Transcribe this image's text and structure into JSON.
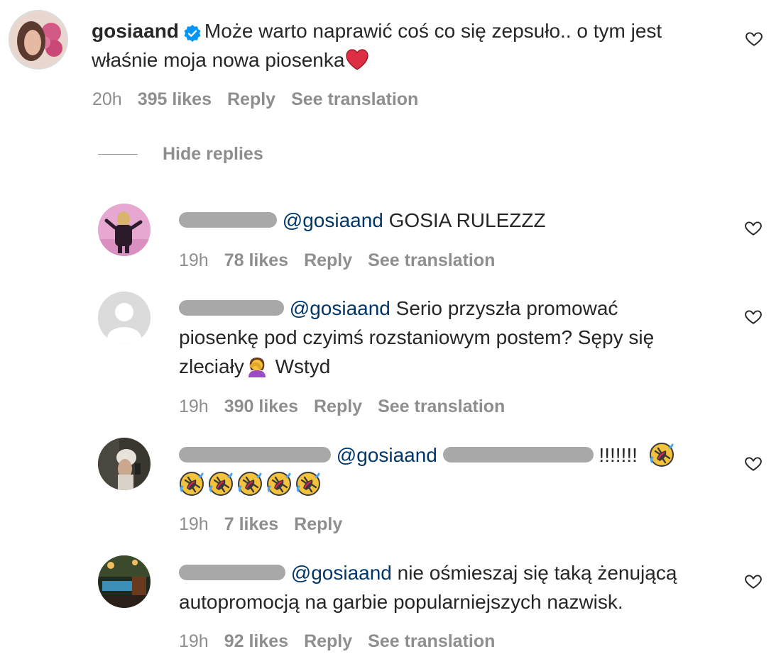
{
  "main_comment": {
    "username": "gosiaand",
    "text": "Może warto naprawić coś co się zepsuło.. o tym jest właśnie moja nowa piosenka",
    "emoji": "red-heart",
    "time": "20h",
    "likes": "395 likes",
    "reply": "Reply",
    "translate": "See translation"
  },
  "hide_replies": "Hide replies",
  "replies": [
    {
      "mention": "@gosiaand",
      "text": "GOSIA RULEZZZ",
      "time": "19h",
      "likes": "78 likes",
      "reply": "Reply",
      "translate": "See translation"
    },
    {
      "mention": "@gosiaand",
      "text_line1": "Serio przyszła promować",
      "text_line2": "piosenkę pod czyimś rozstaniowym postem? Sępy się",
      "text_line3a": "zleciały",
      "text_line3b": "Wstyd",
      "time": "19h",
      "likes": "390 likes",
      "reply": "Reply",
      "translate": "See translation"
    },
    {
      "mention": "@gosiaand",
      "text": "!!!!!!!",
      "time": "19h",
      "likes": "7 likes",
      "reply": "Reply"
    },
    {
      "mention": "@gosiaand",
      "text_line1": "nie ośmieszaj się taką żenującą",
      "text_line2": "autopromocją na garbie popularniejszych nazwisk.",
      "time": "19h",
      "likes": "92 likes",
      "reply": "Reply",
      "translate": "See translation"
    }
  ],
  "colors": {
    "text": "#262626",
    "secondary": "#8e8e8e",
    "mention": "#00376b",
    "verified": "#0095f6",
    "heart": "#e0245e"
  }
}
